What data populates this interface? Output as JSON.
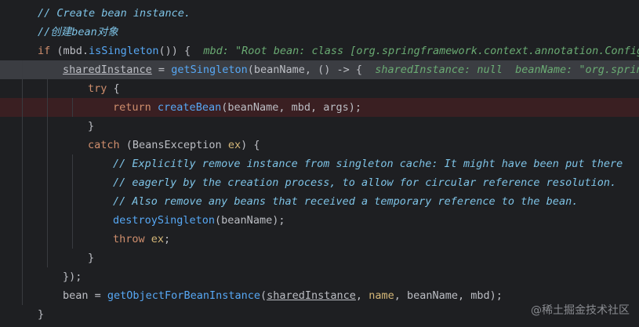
{
  "editor": {
    "lines": [
      {
        "indent": 1,
        "state": "normal",
        "tokens": [
          {
            "t": "// Create bean instance.",
            "c": "cm"
          }
        ]
      },
      {
        "indent": 1,
        "state": "normal",
        "tokens": [
          {
            "t": "//创建bean对象",
            "c": "cm"
          }
        ]
      },
      {
        "indent": 1,
        "state": "normal",
        "tokens": [
          {
            "t": "if",
            "c": "kw"
          },
          {
            "t": " (mbd.",
            "c": "id"
          },
          {
            "t": "isSingleton",
            "c": "fn"
          },
          {
            "t": "()) {  ",
            "c": "id"
          },
          {
            "t": "mbd: \"Root bean: class [org.springframework.context.annotation.Configu",
            "c": "hint"
          }
        ]
      },
      {
        "indent": 2,
        "state": "exec",
        "tokens": [
          {
            "t": "sharedInstance",
            "c": "id ul"
          },
          {
            "t": " = ",
            "c": "id"
          },
          {
            "t": "getSingleton",
            "c": "fn"
          },
          {
            "t": "(beanName, () -> {  ",
            "c": "id"
          },
          {
            "t": "sharedInstance: null  beanName: \"org.spring",
            "c": "hint"
          }
        ]
      },
      {
        "indent": 3,
        "state": "normal",
        "tokens": [
          {
            "t": "try",
            "c": "kw"
          },
          {
            "t": " {",
            "c": "id"
          }
        ]
      },
      {
        "indent": 4,
        "state": "breakpoint",
        "tokens": [
          {
            "t": "return",
            "c": "kw"
          },
          {
            "t": " ",
            "c": "id"
          },
          {
            "t": "createBean",
            "c": "fn"
          },
          {
            "t": "(beanName, mbd, args);",
            "c": "id"
          }
        ]
      },
      {
        "indent": 3,
        "state": "normal",
        "tokens": [
          {
            "t": "}",
            "c": "id"
          }
        ]
      },
      {
        "indent": 3,
        "state": "normal",
        "tokens": [
          {
            "t": "catch",
            "c": "kw"
          },
          {
            "t": " (BeansException ",
            "c": "id"
          },
          {
            "t": "ex",
            "c": "pr"
          },
          {
            "t": ") {",
            "c": "id"
          }
        ]
      },
      {
        "indent": 4,
        "state": "normal",
        "tokens": [
          {
            "t": "// Explicitly remove instance from singleton cache: It might have been put there",
            "c": "cm"
          }
        ]
      },
      {
        "indent": 4,
        "state": "normal",
        "tokens": [
          {
            "t": "// eagerly by the creation process, to allow for circular reference resolution.",
            "c": "cm"
          }
        ]
      },
      {
        "indent": 4,
        "state": "normal",
        "tokens": [
          {
            "t": "// Also remove any beans that received a temporary reference to the bean.",
            "c": "cm"
          }
        ]
      },
      {
        "indent": 4,
        "state": "normal",
        "tokens": [
          {
            "t": "destroySingleton",
            "c": "fn"
          },
          {
            "t": "(beanName);",
            "c": "id"
          }
        ]
      },
      {
        "indent": 4,
        "state": "normal",
        "tokens": [
          {
            "t": "throw",
            "c": "kw"
          },
          {
            "t": " ",
            "c": "id"
          },
          {
            "t": "ex",
            "c": "pr"
          },
          {
            "t": ";",
            "c": "id"
          }
        ]
      },
      {
        "indent": 3,
        "state": "normal",
        "tokens": [
          {
            "t": "}",
            "c": "id"
          }
        ]
      },
      {
        "indent": 2,
        "state": "normal",
        "tokens": [
          {
            "t": "});",
            "c": "id"
          }
        ]
      },
      {
        "indent": 2,
        "state": "normal",
        "tokens": [
          {
            "t": "bean = ",
            "c": "id"
          },
          {
            "t": "getObjectForBeanInstance",
            "c": "fn"
          },
          {
            "t": "(",
            "c": "id"
          },
          {
            "t": "sharedInstance",
            "c": "id ul"
          },
          {
            "t": ", ",
            "c": "id"
          },
          {
            "t": "name",
            "c": "pr"
          },
          {
            "t": ", beanName, mbd);",
            "c": "id"
          }
        ]
      },
      {
        "indent": 1,
        "state": "normal",
        "tokens": [
          {
            "t": "}",
            "c": "id"
          }
        ]
      }
    ]
  },
  "watermark": "@稀土掘金技术社区",
  "colors": {
    "background": "#1e1f22",
    "exec_line": "#3b3d42",
    "breakpoint_line": "#3a1f22",
    "comment": "#7ec3e6",
    "keyword": "#cf8e6d",
    "function": "#57a8f5",
    "identifier": "#bcbec4",
    "param": "#d5b778",
    "inline_hint": "#6aab73"
  }
}
